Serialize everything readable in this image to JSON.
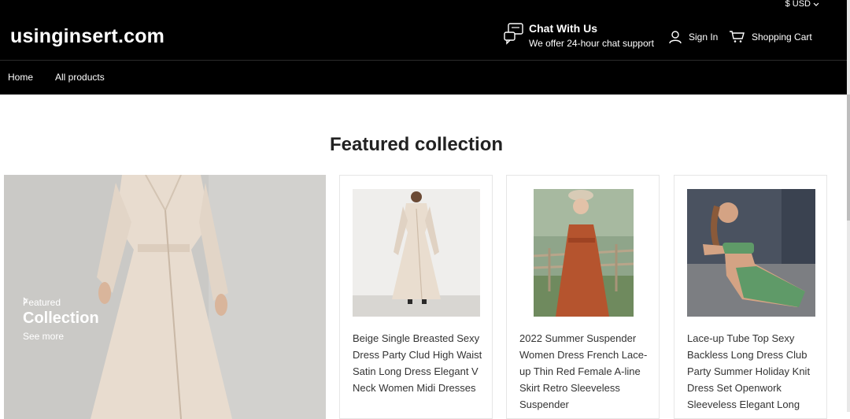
{
  "topbar": {
    "currency": "$ USD"
  },
  "header": {
    "logo": "usinginsert.com",
    "chat_title": "Chat With Us",
    "chat_subtitle": "We offer 24-hour chat support",
    "signin": "Sign In",
    "cart": "Shopping Cart"
  },
  "nav": {
    "items": [
      {
        "label": "Home"
      },
      {
        "label": "All products"
      }
    ]
  },
  "featured": {
    "title": "Featured collection",
    "hero_small": "Featured",
    "hero_big": "Collection",
    "hero_more": "See more"
  },
  "products": [
    {
      "title": "Beige Single Breasted Sexy Dress Party Clud High Waist Satin Long Dress Elegant V Neck Women Midi Dresses"
    },
    {
      "title": "2022 Summer Suspender Women Dress French Lace-up Thin Red Female A-line Skirt Retro Sleeveless Suspender"
    },
    {
      "title": "Lace-up Tube Top Sexy Backless Long Dress Club Party Summer Holiday Knit Dress Set Openwork Sleeveless Elegant Long"
    }
  ],
  "colors": {
    "header_bg": "#000000",
    "text": "#222222",
    "dress_beige": "#e6d9cb",
    "dress_red": "#b5542e",
    "dress_green": "#5f9a68"
  }
}
